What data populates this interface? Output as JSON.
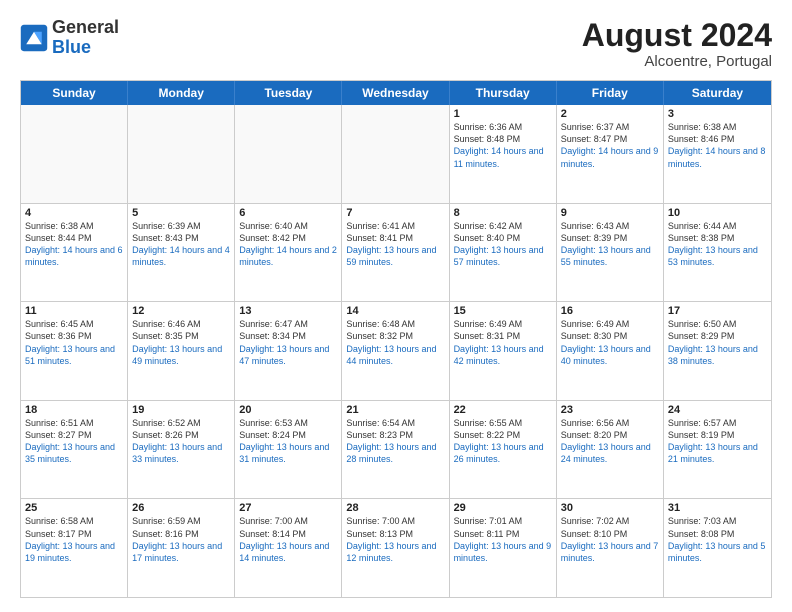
{
  "header": {
    "logo_general": "General",
    "logo_blue": "Blue",
    "month_year": "August 2024",
    "location": "Alcoentre, Portugal"
  },
  "weekdays": [
    "Sunday",
    "Monday",
    "Tuesday",
    "Wednesday",
    "Thursday",
    "Friday",
    "Saturday"
  ],
  "rows": [
    [
      {
        "day": "",
        "sunrise": "",
        "sunset": "",
        "daylight": "",
        "empty": true
      },
      {
        "day": "",
        "sunrise": "",
        "sunset": "",
        "daylight": "",
        "empty": true
      },
      {
        "day": "",
        "sunrise": "",
        "sunset": "",
        "daylight": "",
        "empty": true
      },
      {
        "day": "",
        "sunrise": "",
        "sunset": "",
        "daylight": "",
        "empty": true
      },
      {
        "day": "1",
        "sunrise": "Sunrise: 6:36 AM",
        "sunset": "Sunset: 8:48 PM",
        "daylight": "Daylight: 14 hours and 11 minutes."
      },
      {
        "day": "2",
        "sunrise": "Sunrise: 6:37 AM",
        "sunset": "Sunset: 8:47 PM",
        "daylight": "Daylight: 14 hours and 9 minutes."
      },
      {
        "day": "3",
        "sunrise": "Sunrise: 6:38 AM",
        "sunset": "Sunset: 8:46 PM",
        "daylight": "Daylight: 14 hours and 8 minutes."
      }
    ],
    [
      {
        "day": "4",
        "sunrise": "Sunrise: 6:38 AM",
        "sunset": "Sunset: 8:44 PM",
        "daylight": "Daylight: 14 hours and 6 minutes."
      },
      {
        "day": "5",
        "sunrise": "Sunrise: 6:39 AM",
        "sunset": "Sunset: 8:43 PM",
        "daylight": "Daylight: 14 hours and 4 minutes."
      },
      {
        "day": "6",
        "sunrise": "Sunrise: 6:40 AM",
        "sunset": "Sunset: 8:42 PM",
        "daylight": "Daylight: 14 hours and 2 minutes."
      },
      {
        "day": "7",
        "sunrise": "Sunrise: 6:41 AM",
        "sunset": "Sunset: 8:41 PM",
        "daylight": "Daylight: 13 hours and 59 minutes."
      },
      {
        "day": "8",
        "sunrise": "Sunrise: 6:42 AM",
        "sunset": "Sunset: 8:40 PM",
        "daylight": "Daylight: 13 hours and 57 minutes."
      },
      {
        "day": "9",
        "sunrise": "Sunrise: 6:43 AM",
        "sunset": "Sunset: 8:39 PM",
        "daylight": "Daylight: 13 hours and 55 minutes."
      },
      {
        "day": "10",
        "sunrise": "Sunrise: 6:44 AM",
        "sunset": "Sunset: 8:38 PM",
        "daylight": "Daylight: 13 hours and 53 minutes."
      }
    ],
    [
      {
        "day": "11",
        "sunrise": "Sunrise: 6:45 AM",
        "sunset": "Sunset: 8:36 PM",
        "daylight": "Daylight: 13 hours and 51 minutes."
      },
      {
        "day": "12",
        "sunrise": "Sunrise: 6:46 AM",
        "sunset": "Sunset: 8:35 PM",
        "daylight": "Daylight: 13 hours and 49 minutes."
      },
      {
        "day": "13",
        "sunrise": "Sunrise: 6:47 AM",
        "sunset": "Sunset: 8:34 PM",
        "daylight": "Daylight: 13 hours and 47 minutes."
      },
      {
        "day": "14",
        "sunrise": "Sunrise: 6:48 AM",
        "sunset": "Sunset: 8:32 PM",
        "daylight": "Daylight: 13 hours and 44 minutes."
      },
      {
        "day": "15",
        "sunrise": "Sunrise: 6:49 AM",
        "sunset": "Sunset: 8:31 PM",
        "daylight": "Daylight: 13 hours and 42 minutes."
      },
      {
        "day": "16",
        "sunrise": "Sunrise: 6:49 AM",
        "sunset": "Sunset: 8:30 PM",
        "daylight": "Daylight: 13 hours and 40 minutes."
      },
      {
        "day": "17",
        "sunrise": "Sunrise: 6:50 AM",
        "sunset": "Sunset: 8:29 PM",
        "daylight": "Daylight: 13 hours and 38 minutes."
      }
    ],
    [
      {
        "day": "18",
        "sunrise": "Sunrise: 6:51 AM",
        "sunset": "Sunset: 8:27 PM",
        "daylight": "Daylight: 13 hours and 35 minutes."
      },
      {
        "day": "19",
        "sunrise": "Sunrise: 6:52 AM",
        "sunset": "Sunset: 8:26 PM",
        "daylight": "Daylight: 13 hours and 33 minutes."
      },
      {
        "day": "20",
        "sunrise": "Sunrise: 6:53 AM",
        "sunset": "Sunset: 8:24 PM",
        "daylight": "Daylight: 13 hours and 31 minutes."
      },
      {
        "day": "21",
        "sunrise": "Sunrise: 6:54 AM",
        "sunset": "Sunset: 8:23 PM",
        "daylight": "Daylight: 13 hours and 28 minutes."
      },
      {
        "day": "22",
        "sunrise": "Sunrise: 6:55 AM",
        "sunset": "Sunset: 8:22 PM",
        "daylight": "Daylight: 13 hours and 26 minutes."
      },
      {
        "day": "23",
        "sunrise": "Sunrise: 6:56 AM",
        "sunset": "Sunset: 8:20 PM",
        "daylight": "Daylight: 13 hours and 24 minutes."
      },
      {
        "day": "24",
        "sunrise": "Sunrise: 6:57 AM",
        "sunset": "Sunset: 8:19 PM",
        "daylight": "Daylight: 13 hours and 21 minutes."
      }
    ],
    [
      {
        "day": "25",
        "sunrise": "Sunrise: 6:58 AM",
        "sunset": "Sunset: 8:17 PM",
        "daylight": "Daylight: 13 hours and 19 minutes."
      },
      {
        "day": "26",
        "sunrise": "Sunrise: 6:59 AM",
        "sunset": "Sunset: 8:16 PM",
        "daylight": "Daylight: 13 hours and 17 minutes."
      },
      {
        "day": "27",
        "sunrise": "Sunrise: 7:00 AM",
        "sunset": "Sunset: 8:14 PM",
        "daylight": "Daylight: 13 hours and 14 minutes."
      },
      {
        "day": "28",
        "sunrise": "Sunrise: 7:00 AM",
        "sunset": "Sunset: 8:13 PM",
        "daylight": "Daylight: 13 hours and 12 minutes."
      },
      {
        "day": "29",
        "sunrise": "Sunrise: 7:01 AM",
        "sunset": "Sunset: 8:11 PM",
        "daylight": "Daylight: 13 hours and 9 minutes."
      },
      {
        "day": "30",
        "sunrise": "Sunrise: 7:02 AM",
        "sunset": "Sunset: 8:10 PM",
        "daylight": "Daylight: 13 hours and 7 minutes."
      },
      {
        "day": "31",
        "sunrise": "Sunrise: 7:03 AM",
        "sunset": "Sunset: 8:08 PM",
        "daylight": "Daylight: 13 hours and 5 minutes."
      }
    ]
  ]
}
